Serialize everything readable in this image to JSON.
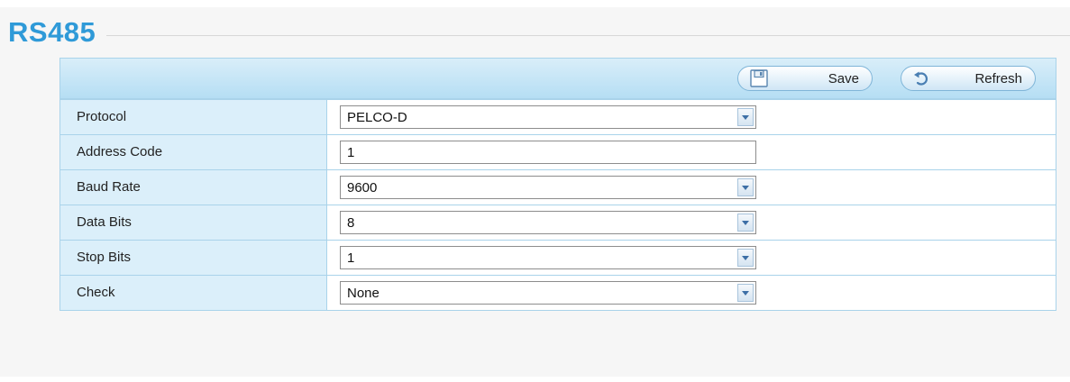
{
  "section_title": "RS485",
  "toolbar": {
    "save_label": "Save",
    "refresh_label": "Refresh"
  },
  "settings": [
    {
      "label": "Protocol",
      "type": "select",
      "value": "PELCO-D"
    },
    {
      "label": "Address Code",
      "type": "text",
      "value": "1"
    },
    {
      "label": "Baud Rate",
      "type": "select",
      "value": "9600"
    },
    {
      "label": "Data Bits",
      "type": "select",
      "value": "8"
    },
    {
      "label": "Stop Bits",
      "type": "select",
      "value": "1"
    },
    {
      "label": "Check",
      "type": "select",
      "value": "None"
    }
  ],
  "colors": {
    "title": "#2f9ad8",
    "toolbar_bg": "#c5e6f7",
    "label_bg": "#dbeffa",
    "border": "#a9d3ea"
  },
  "icons": {
    "save": "floppy-disk-icon",
    "refresh": "refresh-arrow-icon",
    "dropdown": "chevron-down-icon"
  }
}
